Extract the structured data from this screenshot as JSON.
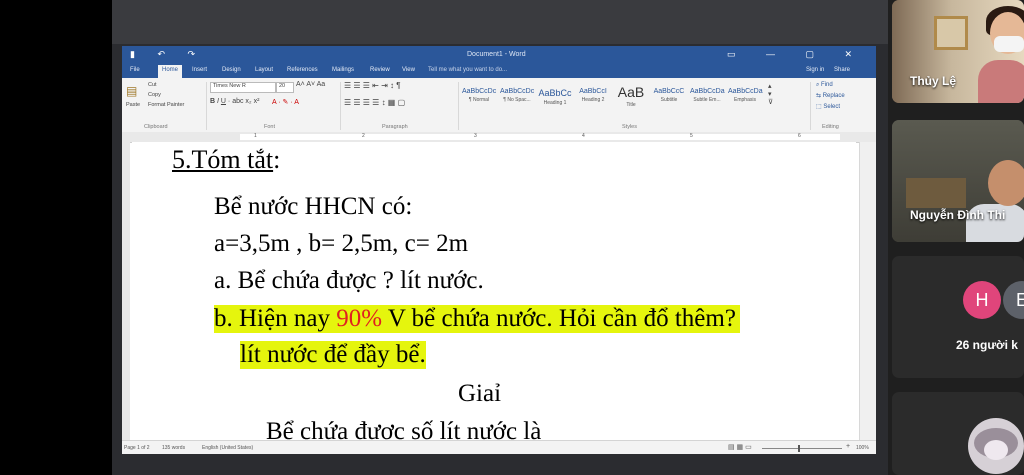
{
  "word": {
    "doc_title": "Document1 - Word",
    "qat_icons": [
      "save-icon",
      "undo-icon",
      "redo-icon"
    ],
    "tabs": [
      "File",
      "Home",
      "Insert",
      "Design",
      "Layout",
      "References",
      "Mailings",
      "Review",
      "View"
    ],
    "active_tab": "Home",
    "tell_me_placeholder": "Tell me what you want to do...",
    "sign_in": "Sign in",
    "share": "Share",
    "clipboard": {
      "paste": "Paste",
      "cut": "Cut",
      "copy": "Copy",
      "format_painter": "Format Painter",
      "group": "Clipboard"
    },
    "font": {
      "name": "Times New R",
      "size": "20",
      "group": "Font"
    },
    "paragraph_group": "Paragraph",
    "styles": [
      {
        "sample": "AaBbCcDc",
        "name": "¶ Normal"
      },
      {
        "sample": "AaBbCcDc",
        "name": "¶ No Spac..."
      },
      {
        "sample": "AaBbCc",
        "name": "Heading 1"
      },
      {
        "sample": "AaBbCcI",
        "name": "Heading 2"
      },
      {
        "sample": "AaB",
        "name": "Title"
      },
      {
        "sample": "AaBbCcC",
        "name": "Subtitle"
      },
      {
        "sample": "AaBbCcDa",
        "name": "Subtle Em..."
      },
      {
        "sample": "AaBbCcDa",
        "name": "Emphasis"
      }
    ],
    "styles_group": "Styles",
    "editing": {
      "find": "Find",
      "replace": "Replace",
      "select": "Select",
      "group": "Editing"
    },
    "ruler_numbers": [
      "1",
      "2",
      "3",
      "4",
      "5",
      "6"
    ],
    "status": {
      "page": "Page 1 of 2",
      "words": "135 words",
      "language": "English (United States)",
      "zoom": "100%"
    }
  },
  "document": {
    "heading_prefix": "5.",
    "heading": "Tóm tắt",
    "heading_colon": ":",
    "line1": "Bể nước HHCN có:",
    "line2": "a=3,5m , b= 2,5m,  c= 2m",
    "line3": "a. Bể chứa được ? lít nước.",
    "line4_a": "b. Hiện nay ",
    "line4_pct": "90%",
    "line4_b": " V bể chứa nước. Hỏi cần đổ thêm?",
    "line5": "lít nước để đầy bể.",
    "line6": "Giaỉ",
    "line7": "Bể chứa được số lít nước là"
  },
  "participants": {
    "tile1_name": "Thủy Lệ",
    "tile2_name": "Nguyễn Đình Thi",
    "avatar1": "H",
    "avatar2": "E",
    "others_count": "26 người k"
  }
}
